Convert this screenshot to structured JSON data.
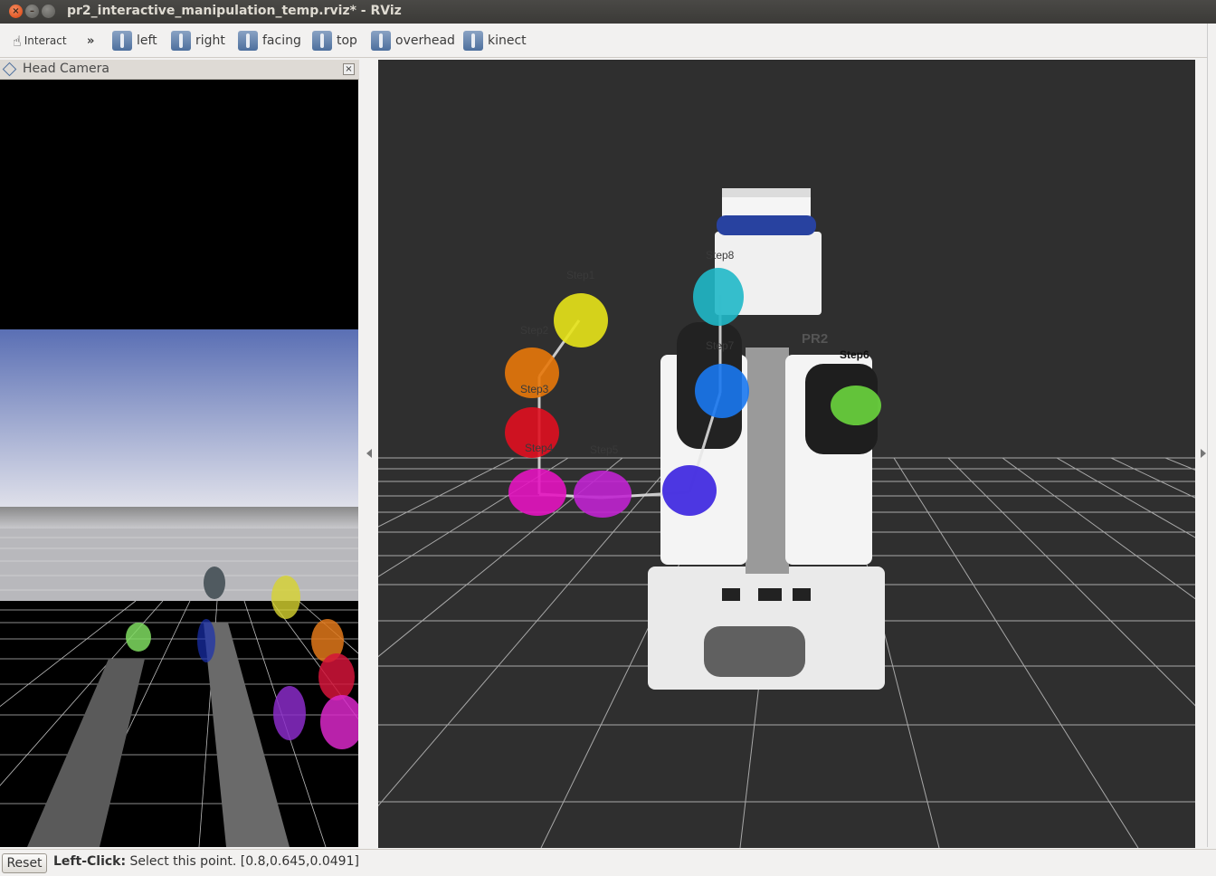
{
  "window": {
    "title": "pr2_interactive_manipulation_temp.rviz* - RViz",
    "close_glyph": "×",
    "min_glyph": "–"
  },
  "toolbar": {
    "interact_label": "Interact",
    "more_label": "»",
    "views": [
      {
        "label": "left",
        "icon": "robot-view-icon"
      },
      {
        "label": "right",
        "icon": "robot-view-icon"
      },
      {
        "label": "facing",
        "icon": "robot-view-icon"
      },
      {
        "label": "top",
        "icon": "robot-view-icon"
      },
      {
        "label": "overhead",
        "icon": "robot-view-icon"
      },
      {
        "label": "kinect",
        "icon": "kinect-view-icon"
      }
    ]
  },
  "panel": {
    "title": "Head Camera",
    "close_glyph": "×"
  },
  "scene": {
    "robot_label": "PR2",
    "steps": [
      "Step1",
      "Step2",
      "Step3",
      "Step4",
      "Step5",
      "Step6",
      "Step7",
      "Step8"
    ]
  },
  "status": {
    "reset_label": "Reset",
    "action": "Left-Click:",
    "description": "Select this point. [0.8,0.645,0.0491]"
  },
  "colors": {
    "accent": "#4d6f9d",
    "background_3d": "#2f2f2f",
    "grid": "#a0a0a0"
  }
}
